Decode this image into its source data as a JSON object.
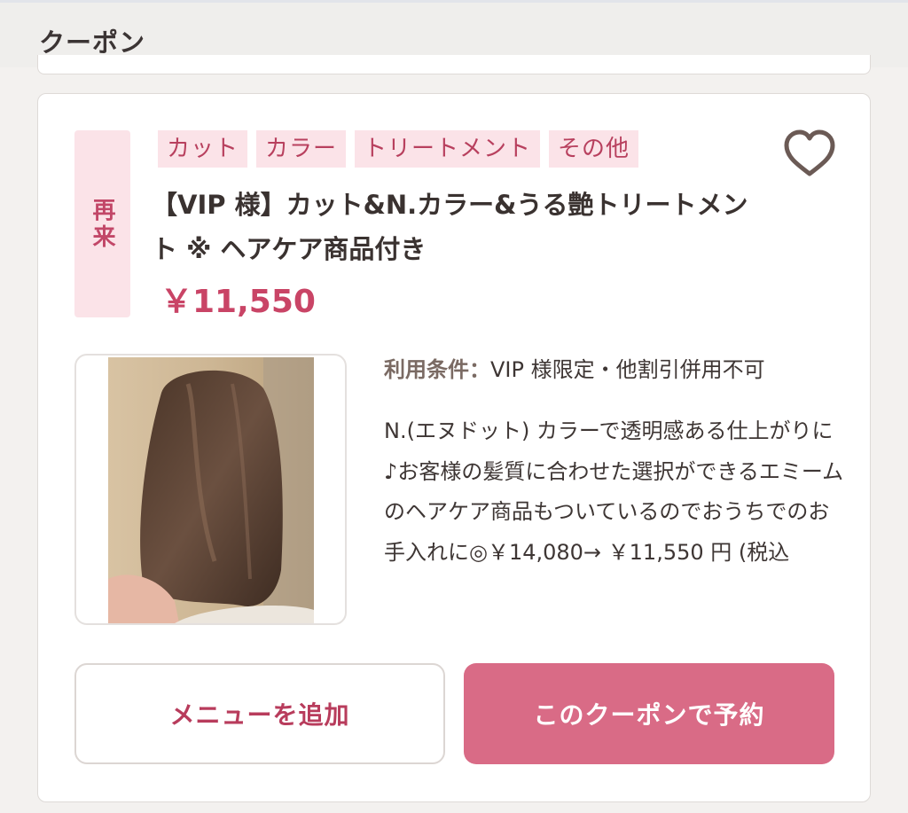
{
  "header": {
    "title": "クーポン"
  },
  "coupon": {
    "badge": "再来",
    "tags": [
      "カット",
      "カラー",
      "トリートメント",
      "その他"
    ],
    "title": "【VIP 様】カット&N.カラー&うる艶トリートメント ※ ヘアケア商品付き",
    "price": "￥11,550",
    "conditions_label": "利用条件：",
    "conditions_value": "VIP 様限定・他割引併用不可",
    "description": "N.(エヌドット) カラーで透明感ある仕上がりに♪お客様の髪質に合わせた選択ができるエミームのヘアケア商品もついているのでおうちでのお手入れに◎￥14,080→ ￥11,550 円 (税込",
    "add_menu_label": "メニューを追加",
    "reserve_label": "このクーポンで予約"
  },
  "colors": {
    "accent": "#c94466",
    "tag_bg": "#fbe3e8",
    "reserve_bg": "#d96b86"
  }
}
